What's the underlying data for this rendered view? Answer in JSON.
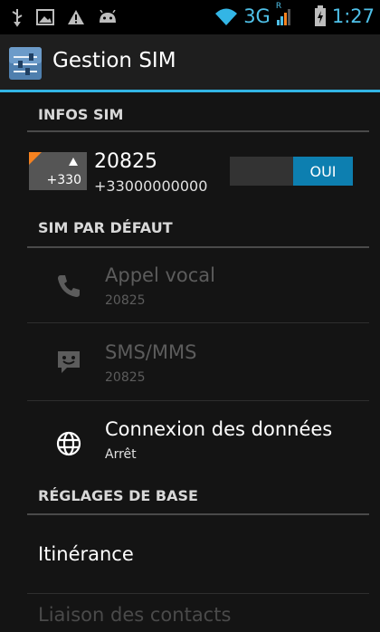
{
  "statusbar": {
    "network": "3G",
    "roaming": "R",
    "time": "1:27",
    "icons": [
      "usb-icon",
      "image-icon",
      "warning-icon",
      "android-icon",
      "wifi-icon",
      "signal-icon",
      "battery-icon"
    ]
  },
  "actionbar": {
    "title": "Gestion SIM",
    "icon": "settings-sliders-icon"
  },
  "sections": {
    "infos": "INFOS SIM",
    "default": "SIM PAR DÉFAUT",
    "basic": "RÉGLAGES DE BASE"
  },
  "sim": {
    "badge_number": "+330",
    "name": "20825",
    "number": "+33000000000",
    "toggle_label": "OUI",
    "toggle_on": true
  },
  "default_items": [
    {
      "title": "Appel vocal",
      "subtitle": "20825",
      "icon": "phone-icon",
      "enabled": false
    },
    {
      "title": "SMS/MMS",
      "subtitle": "20825",
      "icon": "message-icon",
      "enabled": false
    },
    {
      "title": "Connexion des données",
      "subtitle": "Arrêt",
      "icon": "globe-icon",
      "enabled": true
    }
  ],
  "basic_items": [
    {
      "title": "Itinérance",
      "enabled": true
    },
    {
      "title": "Liaison des contacts",
      "enabled": false
    }
  ],
  "colors": {
    "accent": "#33b5e5",
    "toggle_on": "#0d7fb0",
    "sim_corner": "#f58220",
    "disabled_text": "#5c5c5c"
  }
}
